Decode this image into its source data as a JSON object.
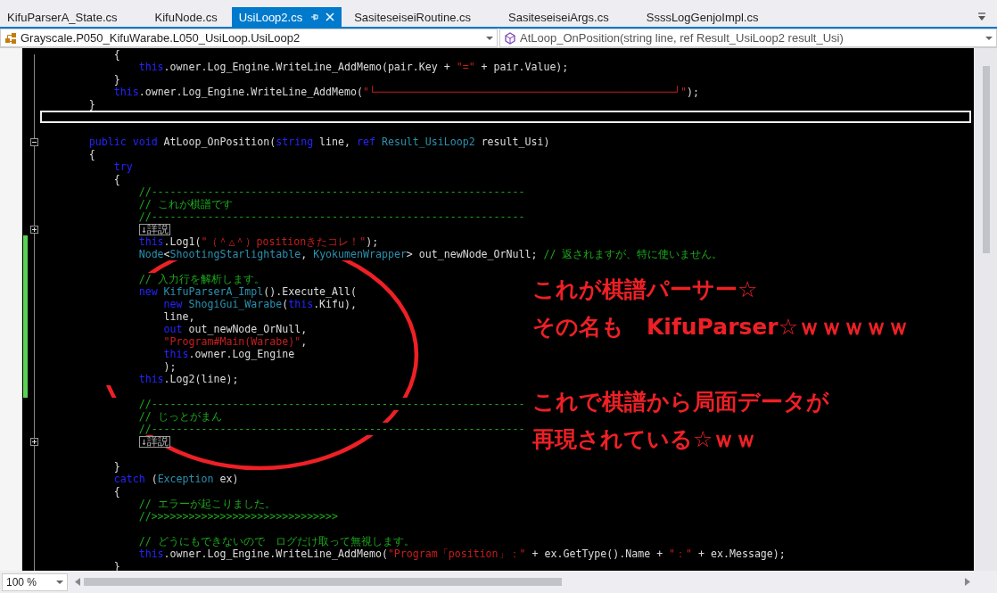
{
  "tabs": [
    {
      "label": "KifuParserA_State.cs",
      "selected": false
    },
    {
      "label": "KifuNode.cs",
      "selected": false
    },
    {
      "label": "UsiLoop2.cs",
      "selected": true
    },
    {
      "label": "SasiteseiseiRoutine.cs",
      "selected": false
    },
    {
      "label": "SasiteseiseiArgs.cs",
      "selected": false
    },
    {
      "label": "SsssLogGenjoImpl.cs",
      "selected": false
    }
  ],
  "navigation": {
    "type_combo": "Grayscale.P050_KifuWarabe.L050_UsiLoop.UsiLoop2",
    "member_combo": "AtLoop_OnPosition(string line, ref Result_UsiLoop2 result_Usi)"
  },
  "lines": [
    {
      "kind": "code",
      "changed": false,
      "tokens": [
        {
          "kind": "plain",
          "text": "            {"
        }
      ]
    },
    {
      "kind": "code",
      "changed": false,
      "tokens": [
        {
          "kind": "keyword",
          "text": "                this"
        },
        {
          "kind": "plain",
          "text": ".owner.Log_Engine.WriteLine_AddMemo(pair.Key + "
        },
        {
          "kind": "string",
          "text": "\"=\""
        },
        {
          "kind": "plain",
          "text": " + pair.Value);"
        }
      ]
    },
    {
      "kind": "code",
      "changed": false,
      "tokens": [
        {
          "kind": "plain",
          "text": "            }"
        }
      ]
    },
    {
      "kind": "code",
      "changed": false,
      "tokens": [
        {
          "kind": "keyword",
          "text": "            this"
        },
        {
          "kind": "plain",
          "text": ".owner.Log_Engine.WriteLine_AddMemo("
        },
        {
          "kind": "string",
          "text": "\"└────────────────────────────────────────────────┘\""
        },
        {
          "kind": "plain",
          "text": ");"
        }
      ]
    },
    {
      "kind": "code",
      "changed": false,
      "tokens": [
        {
          "kind": "plain",
          "text": "        }"
        }
      ]
    },
    {
      "kind": "current",
      "changed": false
    },
    {
      "kind": "code",
      "changed": false
    },
    {
      "kind": "code",
      "changed": false,
      "expanded": true,
      "tokens": [
        {
          "kind": "keyword",
          "text": "        public void"
        },
        {
          "kind": "plain",
          "text": " AtLoop_OnPosition("
        },
        {
          "kind": "keyword",
          "text": "string"
        },
        {
          "kind": "plain",
          "text": " line, "
        },
        {
          "kind": "keyword",
          "text": "ref"
        },
        {
          "kind": "type",
          "text": " Result_UsiLoop2"
        },
        {
          "kind": "plain",
          "text": " result_Usi)"
        }
      ]
    },
    {
      "kind": "code",
      "changed": false,
      "tokens": [
        {
          "kind": "plain",
          "text": "        {"
        }
      ]
    },
    {
      "kind": "code",
      "changed": false,
      "tokens": [
        {
          "kind": "keyword",
          "text": "            try"
        }
      ]
    },
    {
      "kind": "code",
      "changed": false,
      "tokens": [
        {
          "kind": "plain",
          "text": "            {"
        }
      ]
    },
    {
      "kind": "code",
      "changed": false,
      "tokens": [
        {
          "kind": "comment",
          "text": "                //------------------------------------------------------------"
        }
      ]
    },
    {
      "kind": "code",
      "changed": false,
      "tokens": [
        {
          "kind": "comment",
          "text": "                // これが棋譜です"
        }
      ]
    },
    {
      "kind": "code",
      "changed": false,
      "tokens": [
        {
          "kind": "comment",
          "text": "                //------------------------------------------------------------"
        }
      ]
    },
    {
      "kind": "collapsed",
      "changed": false,
      "expanded": false,
      "text": "↓詳説"
    },
    {
      "kind": "code",
      "changed": true,
      "tokens": [
        {
          "kind": "keyword",
          "text": "                this"
        },
        {
          "kind": "plain",
          "text": ".Log1("
        },
        {
          "kind": "string",
          "text": "\"（＾△＾）positionきたコレ！\""
        },
        {
          "kind": "plain",
          "text": ");"
        }
      ]
    },
    {
      "kind": "code",
      "changed": true,
      "tokens": [
        {
          "kind": "type",
          "text": "                Node"
        },
        {
          "kind": "plain",
          "text": "<"
        },
        {
          "kind": "type",
          "text": "ShootingStarlightable"
        },
        {
          "kind": "plain",
          "text": ", "
        },
        {
          "kind": "type",
          "text": "KyokumenWrapper"
        },
        {
          "kind": "plain",
          "text": "> out_newNode_OrNull; "
        },
        {
          "kind": "comment",
          "text": "// 返されますが、特に使いません。"
        }
      ]
    },
    {
      "kind": "code",
      "changed": true
    },
    {
      "kind": "code",
      "changed": true,
      "tokens": [
        {
          "kind": "comment",
          "text": "                // 入力行を解析します。"
        }
      ]
    },
    {
      "kind": "code",
      "changed": true,
      "tokens": [
        {
          "kind": "keyword",
          "text": "                new"
        },
        {
          "kind": "type",
          "text": " KifuParserA_Impl"
        },
        {
          "kind": "plain",
          "text": "().Execute_All("
        }
      ]
    },
    {
      "kind": "code",
      "changed": true,
      "tokens": [
        {
          "kind": "keyword",
          "text": "                    new"
        },
        {
          "kind": "type",
          "text": " ShogiGui_Warabe"
        },
        {
          "kind": "plain",
          "text": "("
        },
        {
          "kind": "keyword",
          "text": "this"
        },
        {
          "kind": "plain",
          "text": ".Kifu),"
        }
      ]
    },
    {
      "kind": "code",
      "changed": true,
      "tokens": [
        {
          "kind": "plain",
          "text": "                    line,"
        }
      ]
    },
    {
      "kind": "code",
      "changed": true,
      "tokens": [
        {
          "kind": "keyword",
          "text": "                    out"
        },
        {
          "kind": "plain",
          "text": " out_newNode_OrNull,"
        }
      ]
    },
    {
      "kind": "code",
      "changed": true,
      "tokens": [
        {
          "kind": "string",
          "text": "                    \"Program#Main(Warabe)\""
        },
        {
          "kind": "plain",
          "text": ","
        }
      ]
    },
    {
      "kind": "code",
      "changed": true,
      "tokens": [
        {
          "kind": "keyword",
          "text": "                    this"
        },
        {
          "kind": "plain",
          "text": ".owner.Log_Engine"
        }
      ]
    },
    {
      "kind": "code",
      "changed": true,
      "tokens": [
        {
          "kind": "plain",
          "text": "                    );"
        }
      ]
    },
    {
      "kind": "code",
      "changed": true,
      "tokens": [
        {
          "kind": "keyword",
          "text": "                this"
        },
        {
          "kind": "plain",
          "text": ".Log2(line);"
        }
      ]
    },
    {
      "kind": "code",
      "changed": true
    },
    {
      "kind": "code",
      "changed": false,
      "tokens": [
        {
          "kind": "comment",
          "text": "                //------------------------------------------------------------"
        }
      ]
    },
    {
      "kind": "code",
      "changed": false,
      "tokens": [
        {
          "kind": "comment",
          "text": "                // じっとがまん"
        }
      ]
    },
    {
      "kind": "code",
      "changed": false,
      "tokens": [
        {
          "kind": "comment",
          "text": "                //------------------------------------------------------------"
        }
      ]
    },
    {
      "kind": "collapsed",
      "changed": false,
      "expanded": false,
      "text": "↓詳説"
    },
    {
      "kind": "code",
      "changed": false
    },
    {
      "kind": "code",
      "changed": false,
      "tokens": [
        {
          "kind": "plain",
          "text": "            }"
        }
      ]
    },
    {
      "kind": "code",
      "changed": false,
      "tokens": [
        {
          "kind": "keyword",
          "text": "            catch"
        },
        {
          "kind": "plain",
          "text": " ("
        },
        {
          "kind": "type",
          "text": "Exception"
        },
        {
          "kind": "plain",
          "text": " ex)"
        }
      ]
    },
    {
      "kind": "code",
      "changed": false,
      "tokens": [
        {
          "kind": "plain",
          "text": "            {"
        }
      ]
    },
    {
      "kind": "code",
      "changed": false,
      "tokens": [
        {
          "kind": "comment",
          "text": "                // エラーが起こりました。"
        }
      ]
    },
    {
      "kind": "code",
      "changed": false,
      "tokens": [
        {
          "kind": "comment",
          "text": "                //>>>>>>>>>>>>>>>>>>>>>>>>>>>>>>"
        }
      ]
    },
    {
      "kind": "code",
      "changed": false
    },
    {
      "kind": "code",
      "changed": false,
      "tokens": [
        {
          "kind": "comment",
          "text": "                // どうにもできないので　ログだけ取って無視します。"
        }
      ]
    },
    {
      "kind": "code",
      "changed": false,
      "tokens": [
        {
          "kind": "keyword",
          "text": "                this"
        },
        {
          "kind": "plain",
          "text": ".owner.Log_Engine.WriteLine_AddMemo("
        },
        {
          "kind": "string",
          "text": "\"Program「position」：\""
        },
        {
          "kind": "plain",
          "text": " + ex.GetType().Name + "
        },
        {
          "kind": "string",
          "text": "\"：\""
        },
        {
          "kind": "plain",
          "text": " + ex.Message);"
        }
      ]
    },
    {
      "kind": "code",
      "changed": false,
      "tokens": [
        {
          "kind": "plain",
          "text": "            }"
        }
      ]
    }
  ],
  "annotation": {
    "paragraphs": [
      [
        "これが棋譜パーサー☆",
        "その名も　KifuParser☆ｗｗｗｗｗ"
      ],
      [
        "これで棋譜から局面データが",
        "再現されている☆ｗｗ"
      ]
    ]
  },
  "status_bar": {
    "zoom": "100 %"
  }
}
